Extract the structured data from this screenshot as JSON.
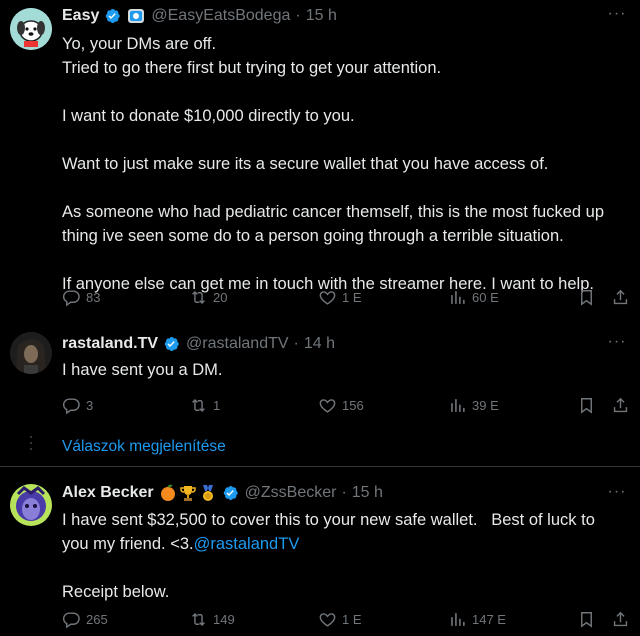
{
  "tweets": [
    {
      "name": "Easy",
      "handle": "@EasyEatsBodega",
      "separator": "·",
      "time": "15 h",
      "lines": [
        "Yo, your DMs are off.",
        "Tried to go there first but trying to get your attention.",
        "",
        "I want to donate $10,000 directly to you.",
        "",
        "Want to just make sure its a secure wallet that you have access of.",
        "",
        "As someone who had pediatric cancer themself, this is the most fucked up",
        "thing ive seen some do to a person going through a terrible situation.",
        "",
        "If anyone else can get me in touch with the streamer here. I want to help."
      ],
      "replies": "83",
      "reposts": "20",
      "likes": "1 E",
      "views": "60 E"
    },
    {
      "name": "rastaland.TV",
      "handle": "@rastalandTV",
      "separator": "·",
      "time": "14 h",
      "text": "I have sent you a DM.",
      "replies": "3",
      "reposts": "1",
      "likes": "156",
      "views": "39 E"
    },
    {
      "name": "Alex Becker",
      "handle": "@ZssBecker",
      "separator": "·",
      "time": "15 h",
      "line1": "I have sent $32,500 to cover this to your new safe wallet.   Best of luck to",
      "line2_text": "you my friend. <3.",
      "line2_link": "@rastalandTV",
      "line3": "Receipt below.",
      "replies": "265",
      "reposts": "149",
      "likes": "1 E",
      "views": "147 E"
    }
  ],
  "show_replies_label": "Válaszok megjelenítése",
  "colors": {
    "accent": "#1d9bf0",
    "muted": "#71767b",
    "background": "#000000",
    "text": "#e7e9ea"
  }
}
